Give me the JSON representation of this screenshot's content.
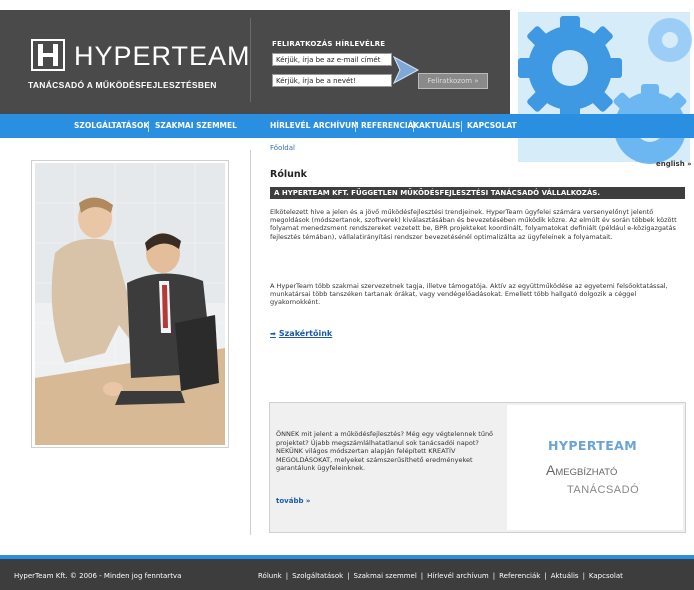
{
  "header": {
    "logo_text": "HYPERTEAM",
    "logo_subtitle": "TANÁCSADÓ A MŰKÖDÉSFEJLESZTÉSBEN",
    "newsletter_title": "FELIRATKOZÁS HÍRLEVÉLRE",
    "email_value": "Kérjük, írja be az e-mail címét",
    "name_value": "Kérjük, írja be a nevét!",
    "subscribe_label": "Feliratkozom »"
  },
  "nav": {
    "items": [
      "SZOLGÁLTATÁSOK",
      "SZAKMAI SZEMMEL",
      "HÍRLEVÉL ARCHÍVUM",
      "REFERENCIÁK",
      "AKTUÁLIS",
      "KAPCSOLAT"
    ],
    "english": "english »"
  },
  "content": {
    "breadcrumb": "Főoldal",
    "title": "Rólunk",
    "banner": "A HYPERTEAM KFT. FÜGGETLEN MŰKÖDÉSFEJLESZTÉSI TANÁCSADÓ VÁLLALKOZÁS.",
    "paragraph1": "Elkötelezett híve a jelen és a jövő működésfejlesztési trendjeinek. HyperTeam ügyfelei számára versenyelőnyt jelentő megoldások (módszertanok, szoftverek) kiválasztásában és bevezetésében működik közre. Az elmúlt év során többek között folyamat menedzsment rendszereket vezetett be, BPR projekteket koordinált, folyamatokat definiált (például e-közigazgatás fejlesztés témában), vállalatirányítási rendszer bevezetésénél optimalizálta az ügyfeleinek a folyamatait.",
    "paragraph2": "A HyperTeam több szakmai szervezetnek tagja, illetve támogatója. Aktív az együttműködése az egyetemi felsőoktatással, munkatársai több tanszéken tartanak órákat, vagy vendégelőadásokat. Emellett több hallgató dolgozik a céggel gyakornokként.",
    "experts_link": "Szakértőink"
  },
  "promo": {
    "text": "ÖNNEK mit jelent a működésfejlesztés? Még egy végtelennek tűnő projektet? Újabb megszámlálhatatlanul sok tanácsadói napot? NEKÜNK világos módszertan alapján felépített KREATÍV MEGOLDÁSOKAT, melyeket számszerűsíthető eredményeket garantálunk ügyfeleinknek.",
    "more": "tovább »",
    "brand": "HYPERTEAM",
    "slogan_line1_big": "A",
    "slogan_line1_rest": "MEGBÍZHATÓ",
    "slogan_line2": "TANÁCSADÓ"
  },
  "footer": {
    "copyright": "HyperTeam Kft. © 2006 - Minden jog fenntartva",
    "links": [
      "Rólunk",
      "Szolgáltatások",
      "Szakmai szemmel",
      "Hírlevél archívum",
      "Referenciák",
      "Aktuális",
      "Kapcsolat"
    ]
  },
  "colors": {
    "header_bg": "#4a4a4a",
    "nav_bg": "#2a8fe0",
    "footer_bg": "#3d3d3d",
    "link": "#1a5aa8"
  }
}
